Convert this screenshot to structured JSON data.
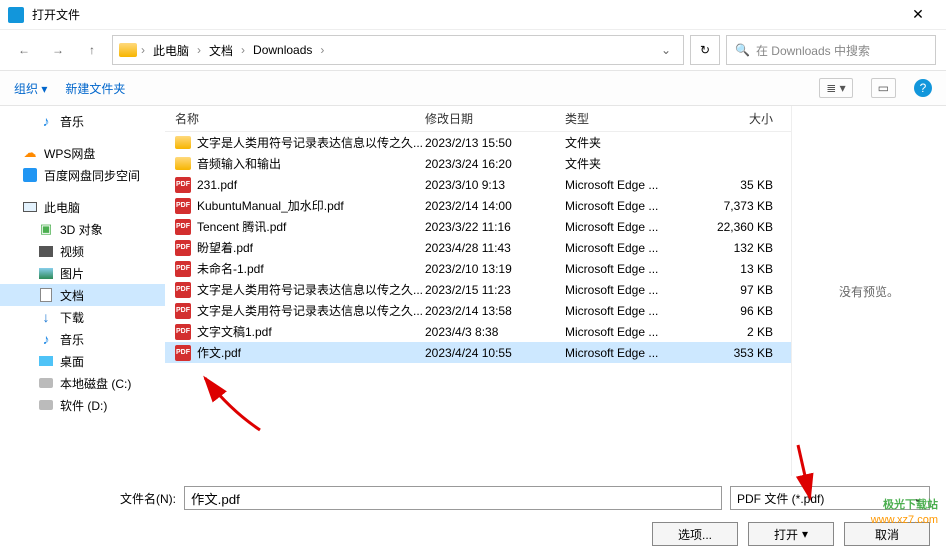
{
  "titlebar": {
    "title": "打开文件",
    "close": "✕"
  },
  "nav": {
    "back": "←",
    "forward": "→",
    "up": "↑",
    "crumbs": [
      "此电脑",
      "文档",
      "Downloads"
    ],
    "refresh": "↻",
    "search_placeholder": "在 Downloads 中搜索"
  },
  "toolbar": {
    "organize": "组织",
    "newfolder": "新建文件夹",
    "help": "?"
  },
  "sidebar": [
    {
      "icon": "music",
      "label": "音乐",
      "lvl": 2
    },
    {
      "icon": "wps",
      "label": "WPS网盘",
      "lvl": 1,
      "gap": true
    },
    {
      "icon": "baidu",
      "label": "百度网盘同步空间",
      "lvl": 1
    },
    {
      "icon": "pc",
      "label": "此电脑",
      "lvl": 1,
      "gap": true
    },
    {
      "icon": "3d",
      "label": "3D 对象",
      "lvl": 2
    },
    {
      "icon": "video",
      "label": "视频",
      "lvl": 2
    },
    {
      "icon": "pic",
      "label": "图片",
      "lvl": 2
    },
    {
      "icon": "doc",
      "label": "文档",
      "lvl": 2,
      "sel": true
    },
    {
      "icon": "dl",
      "label": "下载",
      "lvl": 2
    },
    {
      "icon": "music",
      "label": "音乐",
      "lvl": 2
    },
    {
      "icon": "desk",
      "label": "桌面",
      "lvl": 2
    },
    {
      "icon": "disk",
      "label": "本地磁盘 (C:)",
      "lvl": 2
    },
    {
      "icon": "disk",
      "label": "软件 (D:)",
      "lvl": 2
    }
  ],
  "filelist": {
    "headers": {
      "name": "名称",
      "date": "修改日期",
      "type": "类型",
      "size": "大小"
    },
    "rows": [
      {
        "icon": "folder",
        "name": "文字是人类用符号记录表达信息以传之久...",
        "date": "2023/2/13 15:50",
        "type": "文件夹",
        "size": ""
      },
      {
        "icon": "folder",
        "name": "音频输入和输出",
        "date": "2023/3/24 16:20",
        "type": "文件夹",
        "size": ""
      },
      {
        "icon": "pdf",
        "name": "231.pdf",
        "date": "2023/3/10 9:13",
        "type": "Microsoft Edge ...",
        "size": "35 KB"
      },
      {
        "icon": "pdf",
        "name": "KubuntuManual_加水印.pdf",
        "date": "2023/2/14 14:00",
        "type": "Microsoft Edge ...",
        "size": "7,373 KB"
      },
      {
        "icon": "pdf",
        "name": "Tencent 腾讯.pdf",
        "date": "2023/3/22 11:16",
        "type": "Microsoft Edge ...",
        "size": "22,360 KB"
      },
      {
        "icon": "pdf",
        "name": "盼望着.pdf",
        "date": "2023/4/28 11:43",
        "type": "Microsoft Edge ...",
        "size": "132 KB"
      },
      {
        "icon": "pdf",
        "name": "未命名-1.pdf",
        "date": "2023/2/10 13:19",
        "type": "Microsoft Edge ...",
        "size": "13 KB"
      },
      {
        "icon": "pdf",
        "name": "文字是人类用符号记录表达信息以传之久...",
        "date": "2023/2/15 11:23",
        "type": "Microsoft Edge ...",
        "size": "97 KB"
      },
      {
        "icon": "pdf",
        "name": "文字是人类用符号记录表达信息以传之久...",
        "date": "2023/2/14 13:58",
        "type": "Microsoft Edge ...",
        "size": "96 KB"
      },
      {
        "icon": "pdf",
        "name": "文字文稿1.pdf",
        "date": "2023/4/3 8:38",
        "type": "Microsoft Edge ...",
        "size": "2 KB"
      },
      {
        "icon": "pdf",
        "name": "作文.pdf",
        "date": "2023/4/24 10:55",
        "type": "Microsoft Edge ...",
        "size": "353 KB",
        "sel": true
      }
    ]
  },
  "preview": {
    "none": "没有预览。"
  },
  "footer": {
    "filename_label": "文件名(N):",
    "filename_value": "作文.pdf",
    "filetype": "PDF 文件 (*.pdf)",
    "options": "选项...",
    "open": "打开",
    "cancel": "取消"
  },
  "watermark": {
    "cn": "极光下载站",
    "url": "www.xz7.com"
  }
}
